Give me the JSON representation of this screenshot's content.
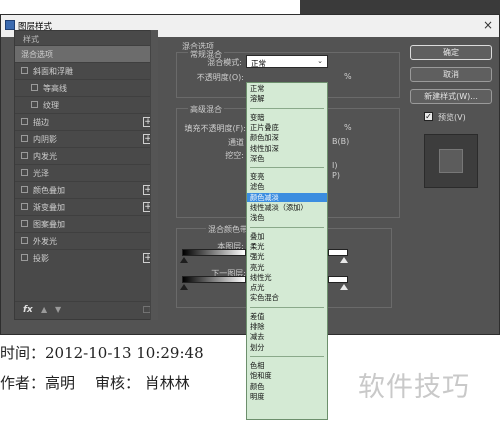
{
  "background": {
    "line1": "时间：2012-10-13  10:29:48",
    "author": "作者：高明",
    "reviewer": "审核：  肖林林",
    "watermark": "软件技巧"
  },
  "dialog": {
    "title": "图层样式",
    "close": "×"
  },
  "styles_panel": {
    "header": "样式",
    "items": [
      {
        "label": "混合选项",
        "selected": true,
        "checkbox": false,
        "indent": false,
        "plus": false
      },
      {
        "label": "斜面和浮雕",
        "checkbox": true,
        "indent": false,
        "plus": false
      },
      {
        "label": "等高线",
        "checkbox": true,
        "indent": true,
        "plus": false
      },
      {
        "label": "纹理",
        "checkbox": true,
        "indent": true,
        "plus": false
      },
      {
        "label": "描边",
        "checkbox": true,
        "indent": false,
        "plus": true
      },
      {
        "label": "内阴影",
        "checkbox": true,
        "indent": false,
        "plus": true
      },
      {
        "label": "内发光",
        "checkbox": true,
        "indent": false,
        "plus": false
      },
      {
        "label": "光泽",
        "checkbox": true,
        "indent": false,
        "plus": false
      },
      {
        "label": "颜色叠加",
        "checkbox": true,
        "indent": false,
        "plus": true
      },
      {
        "label": "渐变叠加",
        "checkbox": true,
        "indent": false,
        "plus": true
      },
      {
        "label": "图案叠加",
        "checkbox": true,
        "indent": false,
        "plus": false
      },
      {
        "label": "外发光",
        "checkbox": true,
        "indent": false,
        "plus": false
      },
      {
        "label": "投影",
        "checkbox": true,
        "indent": false,
        "plus": true
      }
    ],
    "footer": {
      "fx": "fx",
      "up": "▲",
      "down": "▼",
      "trash": "🗑"
    }
  },
  "blend_options": {
    "title": "混合选项",
    "general_title": "常规混合",
    "mode_label": "混合模式:",
    "mode_value": "正常",
    "opacity_label": "不透明度(O):",
    "opacity_unit": "%",
    "advanced_title": "高级混合",
    "fill_label": "填充不透明度(F):",
    "fill_unit": "%",
    "channels_label": "通道",
    "channels_b": "B(B)",
    "knockout_label": "挖空:",
    "opt1": "I)",
    "opt2": "P)",
    "blend_if_label": "混合颜色带:",
    "this_layer_label": "本图层:",
    "under_layer_label": "下一图层:"
  },
  "blend_modes": [
    [
      "正常",
      "溶解"
    ],
    [
      "变暗",
      "正片叠底",
      "颜色加深",
      "线性加深",
      "深色"
    ],
    [
      "变亮",
      "滤色",
      "颜色减淡",
      "线性减淡（添加）",
      "浅色"
    ],
    [
      "叠加",
      "柔光",
      "强光",
      "亮光",
      "线性光",
      "点光",
      "实色混合"
    ],
    [
      "差值",
      "排除",
      "减去",
      "划分"
    ],
    [
      "色相",
      "饱和度",
      "颜色",
      "明度"
    ]
  ],
  "highlighted_mode": "颜色减淡",
  "buttons": {
    "ok": "确定",
    "cancel": "取消",
    "new_style": "新建样式(W)...",
    "preview": "预览(V)",
    "preview_checked": "✓"
  }
}
